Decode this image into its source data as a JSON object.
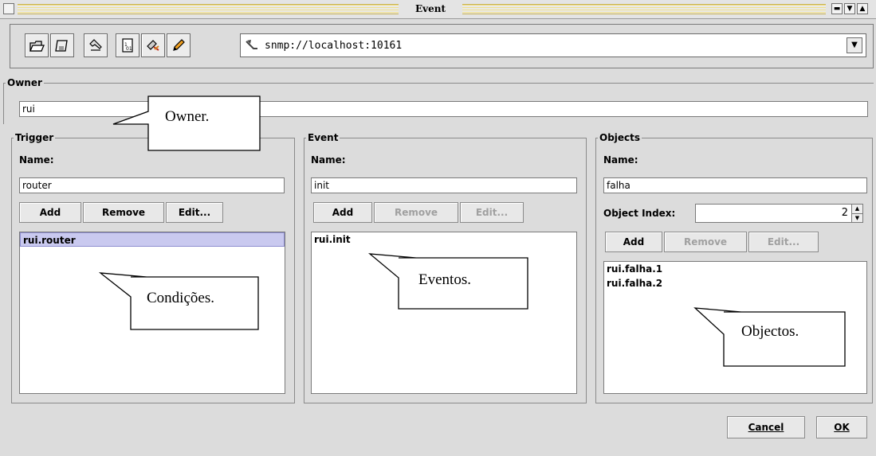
{
  "window": {
    "title": "Event"
  },
  "toolbar": {
    "icons": [
      "open-folder-icon",
      "save-disk-icon",
      "wrench-icon",
      "document-icon",
      "tools-icon",
      "pencil-icon"
    ],
    "url": "snmp://localhost:10161"
  },
  "owner": {
    "group_label": "Owner",
    "value": "rui"
  },
  "trigger": {
    "group_label": "Trigger",
    "name_label": "Name:",
    "name_value": "router",
    "add_label": "Add",
    "remove_label": "Remove",
    "edit_label": "Edit...",
    "items": [
      "rui.router"
    ]
  },
  "event": {
    "group_label": "Event",
    "name_label": "Name:",
    "name_value": "init",
    "add_label": "Add",
    "remove_label": "Remove",
    "edit_label": "Edit...",
    "items": [
      "rui.init"
    ]
  },
  "objects": {
    "group_label": "Objects",
    "name_label": "Name:",
    "name_value": "falha",
    "index_label": "Object Index:",
    "index_value": "2",
    "add_label": "Add",
    "remove_label": "Remove",
    "edit_label": "Edit...",
    "items": [
      "rui.falha.1",
      "rui.falha.2"
    ]
  },
  "footer": {
    "cancel_label": "Cancel",
    "ok_label": "OK"
  },
  "annotations": {
    "owner": "Owner.",
    "trigger": "Condições.",
    "event": "Eventos.",
    "objects": "Objectos."
  }
}
